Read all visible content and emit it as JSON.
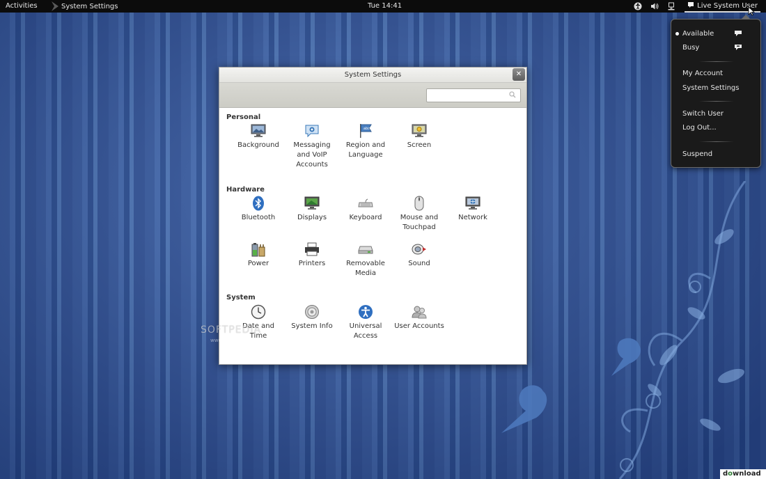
{
  "topbar": {
    "activities": "Activities",
    "app_name": "System Settings",
    "clock": "Tue 14:41",
    "user_name": "Live System User",
    "icons": [
      "accessibility-icon",
      "volume-icon",
      "network-icon",
      "chat-icon"
    ]
  },
  "window": {
    "title": "System Settings",
    "close_label": "✕",
    "search_placeholder": "",
    "sections": [
      {
        "title": "Personal",
        "items": [
          {
            "label": "Background",
            "icon": "background-icon"
          },
          {
            "label": "Messaging and VoIP Accounts",
            "icon": "messaging-icon"
          },
          {
            "label": "Region and Language",
            "icon": "region-flag-icon"
          },
          {
            "label": "Screen",
            "icon": "screen-icon"
          }
        ]
      },
      {
        "title": "Hardware",
        "items": [
          {
            "label": "Bluetooth",
            "icon": "bluetooth-icon"
          },
          {
            "label": "Displays",
            "icon": "displays-icon"
          },
          {
            "label": "Keyboard",
            "icon": "keyboard-icon"
          },
          {
            "label": "Mouse and Touchpad",
            "icon": "mouse-icon"
          },
          {
            "label": "Network",
            "icon": "network-icon"
          },
          {
            "label": "Power",
            "icon": "power-icon"
          },
          {
            "label": "Printers",
            "icon": "printer-icon"
          },
          {
            "label": "Removable Media",
            "icon": "removable-media-icon"
          },
          {
            "label": "Sound",
            "icon": "sound-icon"
          }
        ]
      },
      {
        "title": "System",
        "items": [
          {
            "label": "Date and Time",
            "icon": "clock-icon"
          },
          {
            "label": "System Info",
            "icon": "system-info-icon"
          },
          {
            "label": "Universal Access",
            "icon": "universal-access-icon"
          },
          {
            "label": "User Accounts",
            "icon": "user-accounts-icon"
          }
        ]
      }
    ]
  },
  "user_menu": {
    "available": "Available",
    "busy": "Busy",
    "my_account": "My Account",
    "system_settings": "System Settings",
    "switch_user": "Switch User",
    "log_out": "Log Out...",
    "suspend": "Suspend"
  },
  "watermark": {
    "text": "SOFTPEDIA",
    "sub": "www.softpedia.com"
  },
  "corner_logo": {
    "prefix": "d",
    "accent": "o",
    "suffix": "wnload"
  },
  "colors": {
    "topbar": "#0c0c0c",
    "wallpaper": "#3d62a8",
    "window_toolbar": "#d4d4ce",
    "menu_bg": "#1a1a1a"
  }
}
